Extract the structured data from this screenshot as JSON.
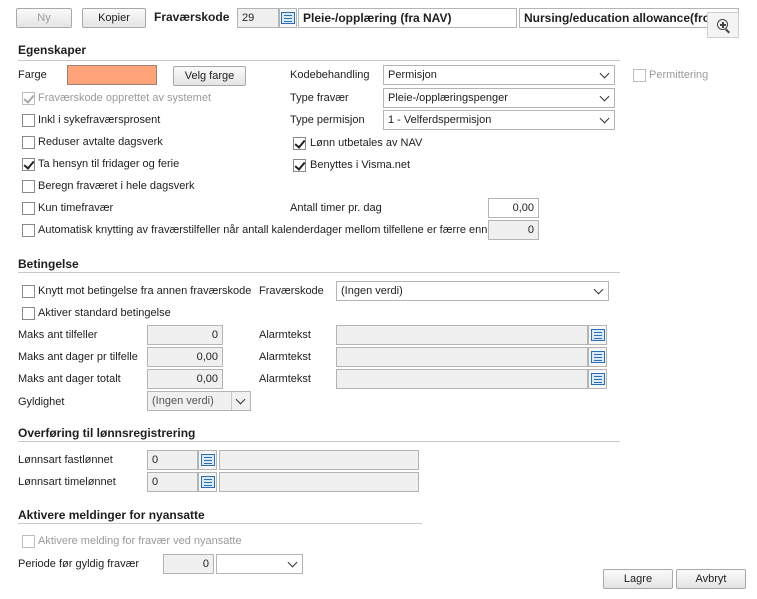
{
  "toolbar": {
    "new_label": "Ny",
    "copy_label": "Kopier",
    "code_label": "Fraværskode",
    "code_value": "29",
    "name_no": "Pleie-/opplæring (fra NAV)",
    "name_en": "Nursing/education allowance(from"
  },
  "egenskaper": {
    "title": "Egenskaper",
    "farge_label": "Farge",
    "farge_color": "#ffa37a",
    "velg_farge": "Velg farge",
    "system_created": "Fraværskode opprettet av systemet",
    "inkl_syk": "Inkl i sykefraværsprosent",
    "reduser": "Reduser avtalte dagsverk",
    "ta_hensyn": "Ta hensyn til fridager og ferie",
    "beregn": "Beregn fraværet i hele dagsverk",
    "kun_time": "Kun timefravær",
    "automatisk": "Automatisk knytting av fraværstilfeller når antall kalenderdager mellom tilfellene er færre enn",
    "automatisk_value": "0",
    "kodebehandling_label": "Kodebehandling",
    "kodebehandling_value": "Permisjon",
    "permittering": "Permittering",
    "type_fravaer_label": "Type fravær",
    "type_fravaer_value": "Pleie-/opplæringspenger",
    "type_permisjon_label": "Type permisjon",
    "type_permisjon_value": "1 - Velferdspermisjon",
    "lonn_nav": "Lønn utbetales av NAV",
    "visma": "Benyttes i Visma.net",
    "antall_timer_label": "Antall timer pr. dag",
    "antall_timer_value": "0,00"
  },
  "betingelse": {
    "title": "Betingelse",
    "knytt": "Knytt mot betingelse fra annen fraværskode",
    "fravaerskode_label": "Fraværskode",
    "fravaerskode_value": "(Ingen verdi)",
    "aktiver_std": "Aktiver standard betingelse",
    "maks_tilfeller_label": "Maks ant tilfeller",
    "maks_tilfeller_value": "0",
    "maks_dager_tilfelle_label": "Maks ant dager pr tilfelle",
    "maks_dager_tilfelle_value": "0,00",
    "maks_dager_totalt_label": "Maks ant dager totalt",
    "maks_dager_totalt_value": "0,00",
    "alarmtekst_label": "Alarmtekst",
    "gyldighet_label": "Gyldighet",
    "gyldighet_value": "(Ingen verdi)"
  },
  "overforing": {
    "title": "Overføring til lønnsregistrering",
    "fast_label": "Lønnsart fastlønnet",
    "fast_value": "0",
    "time_label": "Lønnsart timelønnet",
    "time_value": "0"
  },
  "meldinger": {
    "title": "Aktivere meldinger for nyansatte",
    "aktivere": "Aktivere melding for fravær ved nyansatte",
    "periode_label": "Periode før gyldig fravær",
    "periode_value": "0"
  },
  "footer": {
    "lagre": "Lagre",
    "avbryt": "Avbryt"
  },
  "icons": {
    "zoom": "magnifier-plus-icon",
    "lookup": "list-lookup-icon"
  }
}
